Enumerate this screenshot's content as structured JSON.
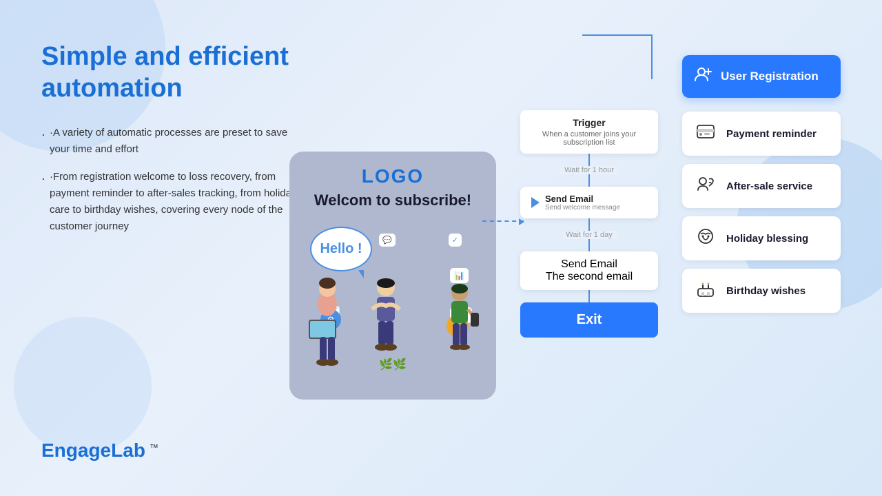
{
  "page": {
    "bg": "#dce8f8"
  },
  "left": {
    "title_line1": "Simple and efficient",
    "title_line2": "automation",
    "desc1": "·A variety of automatic processes are preset to save your time and effort",
    "desc2": "·From registration welcome to loss recovery, from payment reminder to after-sales tracking, from holiday care to birthday wishes, covering every node of the customer journey"
  },
  "brand": {
    "name_part1": "Engage",
    "name_part2": "Lab",
    "tm": "™"
  },
  "card": {
    "logo": "LOGO",
    "title": "Welcom to subscribe!",
    "speech": "Hello !"
  },
  "workflow": {
    "trigger_title": "Trigger",
    "trigger_sub": "When a customer joins your subscription list",
    "wait1": "Wait for 1 hour",
    "email1_title": "Send Email",
    "email1_sub": "Send welcome message",
    "wait2": "Wait for 1 day",
    "email2_title": "Send Email",
    "email2_sub": "The second email",
    "exit": "Exit"
  },
  "right": {
    "user_reg": "User Registration",
    "payment": "Payment reminder",
    "aftersale": "After-sale service",
    "holiday": "Holiday blessing",
    "birthday": "Birthday wishes"
  }
}
